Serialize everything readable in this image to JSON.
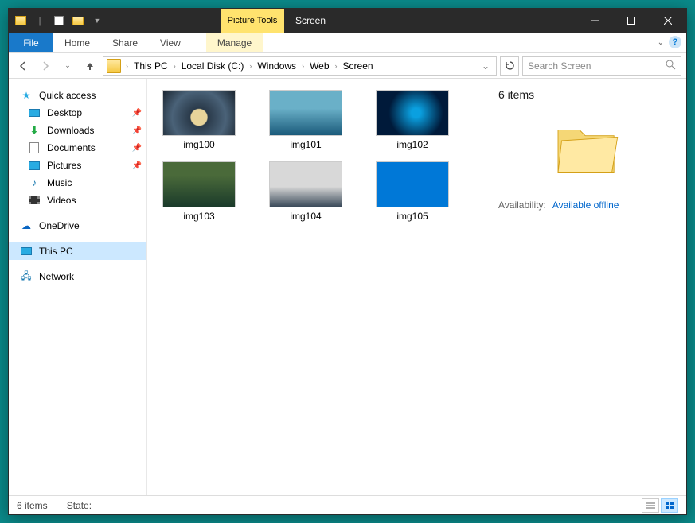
{
  "titlebar": {
    "contextual_label": "Picture Tools",
    "title": "Screen"
  },
  "ribbon": {
    "file": "File",
    "tabs": [
      "Home",
      "Share",
      "View"
    ],
    "context_tab": "Manage"
  },
  "breadcrumb": {
    "segments": [
      "This PC",
      "Local Disk (C:)",
      "Windows",
      "Web",
      "Screen"
    ]
  },
  "search": {
    "placeholder": "Search Screen"
  },
  "sidebar": {
    "quick_access": "Quick access",
    "pinned": [
      "Desktop",
      "Downloads",
      "Documents",
      "Pictures"
    ],
    "libs": [
      "Music",
      "Videos"
    ],
    "onedrive": "OneDrive",
    "thispc": "This PC",
    "network": "Network"
  },
  "items": [
    {
      "name": "img100",
      "thumb": "t0"
    },
    {
      "name": "img101",
      "thumb": "t1"
    },
    {
      "name": "img102",
      "thumb": "t2"
    },
    {
      "name": "img103",
      "thumb": "t3"
    },
    {
      "name": "img104",
      "thumb": "t4"
    },
    {
      "name": "img105",
      "thumb": "t5"
    }
  ],
  "details": {
    "heading": "6 items",
    "availability_label": "Availability:",
    "availability_value": "Available offline"
  },
  "status": {
    "count": "6 items",
    "state_label": "State:"
  }
}
